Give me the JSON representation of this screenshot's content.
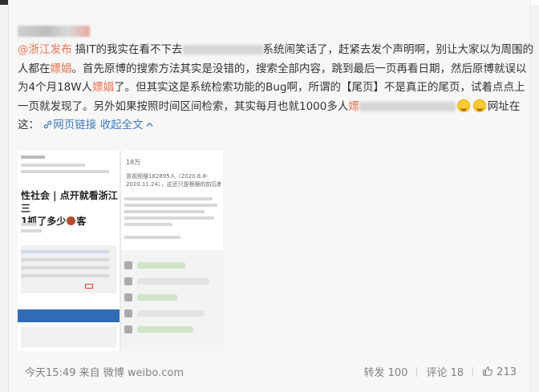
{
  "post": {
    "mention": "@浙江发布",
    "line1_a": "搞IT的我实在看不下去",
    "line1_b": "系统闹笑话了，赶紧去发个声明啊，别让大家以为周围的",
    "line2_a": "人都在",
    "keyword": "嫖娼",
    "line2_b": "。首先原博的搜索方法其实是没错的，搜索全部内容，跳到最后一页再看日期，然后原博就误以",
    "line3_a": "为4个月18W人",
    "line3_b": "了。但其实这是系统检索功能的Bug啊，所谓的【尾页】不是真正的尾页，试着点点上",
    "line4_a": "一页就发现了。另外如果按照时间区间检索，其实每月也就1000多人",
    "line4_keyword": "嫖",
    "line4_b": "网址在",
    "line5_a": "这：",
    "web_link": "网页链接",
    "collapse": "收起全文"
  },
  "thumbnail_left": {
    "headline_1": "性社会 | 点开就看浙江三",
    "headline_2": "1抓了多少",
    "headline_2_end": "客"
  },
  "thumbnail_right": {
    "top_count": "18万",
    "body_line_1": "浙视频搜182895人（2020.8.8-",
    "body_line_2": "2020.11.24），这还只是根据的前后着前"
  },
  "footer": {
    "timestamp": "今天15:49 来自 微博 weibo.com",
    "repost_label": "转发",
    "repost_count": "100",
    "comment_label": "评论",
    "comment_count": "18",
    "like_count": "213"
  },
  "colors": {
    "link_orange": "#eb7350",
    "link_blue": "#3f7ac0",
    "meta_grey": "#808080"
  },
  "icons": {
    "link": "link-icon",
    "collapse": "chevron-up-icon",
    "like": "thumbs-up-icon",
    "emoji": "laughing-tears-emoji"
  }
}
